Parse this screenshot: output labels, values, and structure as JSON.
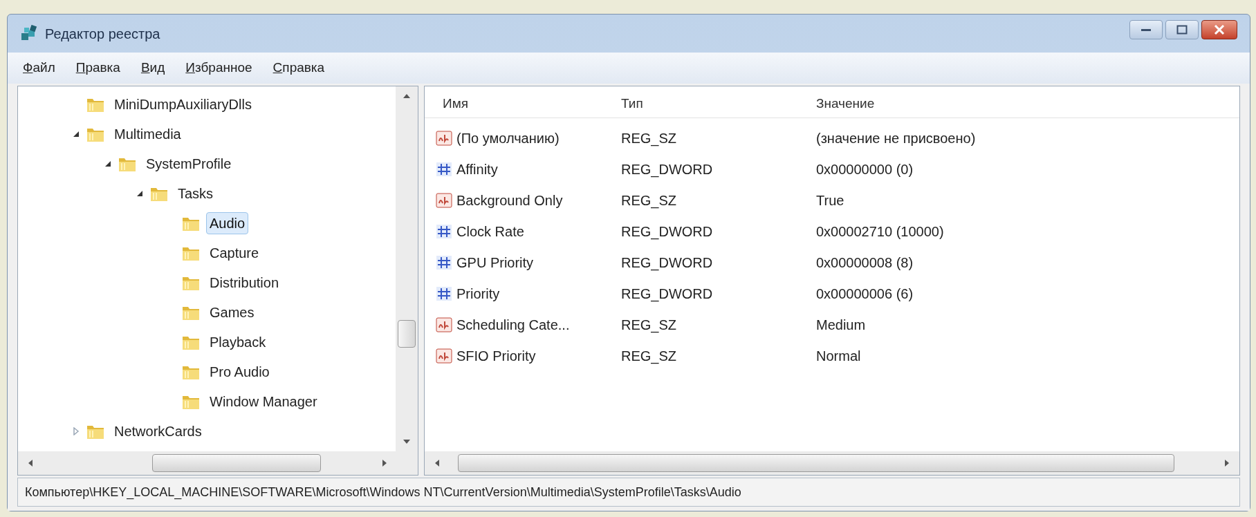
{
  "window": {
    "title": "Редактор реестра"
  },
  "menu": [
    "Файл",
    "Правка",
    "Вид",
    "Избранное",
    "Справка"
  ],
  "tree": [
    {
      "label": "MiniDumpAuxiliaryDlls",
      "selected": false
    },
    {
      "label": "Multimedia",
      "expanded": true,
      "selected": false,
      "children": [
        {
          "label": "SystemProfile",
          "expanded": true,
          "selected": false,
          "children": [
            {
              "label": "Tasks",
              "expanded": true,
              "selected": false,
              "children": [
                {
                  "label": "Audio",
                  "selected": true
                },
                {
                  "label": "Capture",
                  "selected": false
                },
                {
                  "label": "Distribution",
                  "selected": false
                },
                {
                  "label": "Games",
                  "selected": false
                },
                {
                  "label": "Playback",
                  "selected": false
                },
                {
                  "label": "Pro Audio",
                  "selected": false
                },
                {
                  "label": "Window Manager",
                  "selected": false
                }
              ]
            }
          ]
        }
      ]
    },
    {
      "label": "NetworkCards",
      "expanded": false,
      "selected": false
    }
  ],
  "columns": [
    "Имя",
    "Тип",
    "Значение"
  ],
  "values": [
    {
      "kind": "string",
      "name": "(По умолчанию)",
      "type": "REG_SZ",
      "value": "(значение не присвоено)"
    },
    {
      "kind": "number",
      "name": "Affinity",
      "type": "REG_DWORD",
      "value": "0x00000000 (0)"
    },
    {
      "kind": "string",
      "name": "Background Only",
      "type": "REG_SZ",
      "value": "True"
    },
    {
      "kind": "number",
      "name": "Clock Rate",
      "type": "REG_DWORD",
      "value": "0x00002710 (10000)"
    },
    {
      "kind": "number",
      "name": "GPU Priority",
      "type": "REG_DWORD",
      "value": "0x00000008 (8)"
    },
    {
      "kind": "number",
      "name": "Priority",
      "type": "REG_DWORD",
      "value": "0x00000006 (6)"
    },
    {
      "kind": "string",
      "name": "Scheduling Cate...",
      "type": "REG_SZ",
      "value": "Medium"
    },
    {
      "kind": "string",
      "name": "SFIO Priority",
      "type": "REG_SZ",
      "value": "Normal"
    }
  ],
  "status_bar": "Компьютер\\HKEY_LOCAL_MACHINE\\SOFTWARE\\Microsoft\\Windows NT\\CurrentVersion\\Multimedia\\SystemProfile\\Tasks\\Audio"
}
